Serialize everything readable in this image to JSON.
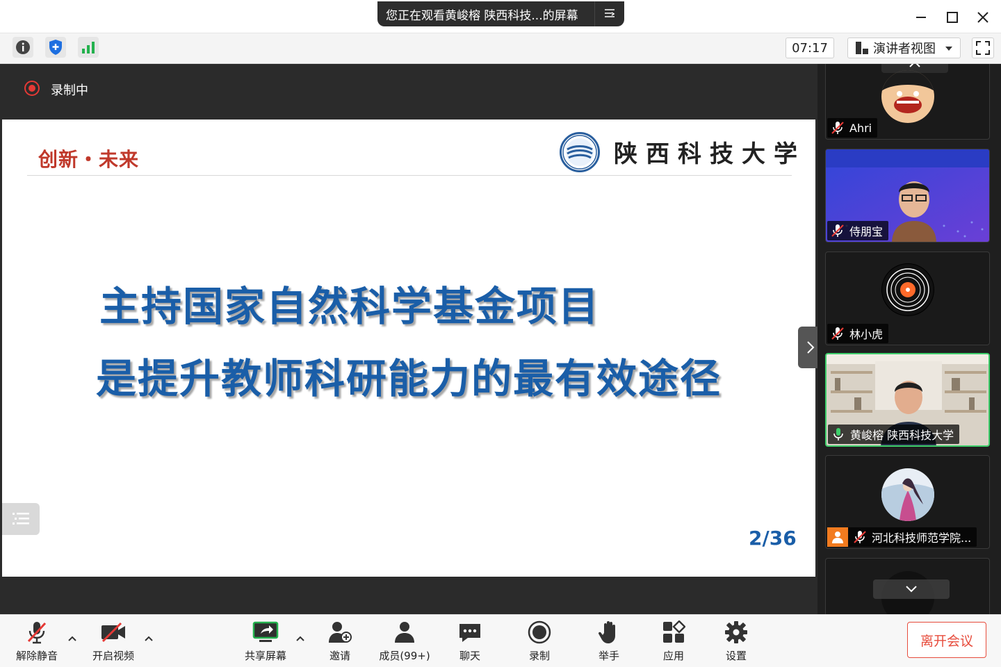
{
  "window": {
    "share_notice": "您正在观看黄峻榕 陕西科技...的屏幕"
  },
  "toolbar": {
    "timer": "07:17",
    "view_label": "演讲者视图"
  },
  "recording": {
    "label": "录制中"
  },
  "slide": {
    "motto": "创新・未来",
    "university": "陕西科技大学",
    "title_line1": "主持国家自然科学基金项目",
    "title_line2": "是提升教师科研能力的最有效途径",
    "page": "2/36"
  },
  "participants": [
    {
      "name": "Ahri",
      "muted": true
    },
    {
      "name": "侍朋宝",
      "muted": true
    },
    {
      "name": "林小虎",
      "muted": true
    },
    {
      "name": "黄峻榕 陕西科技大学",
      "muted": false,
      "speaking": true
    },
    {
      "name": "河北科技师范学院...",
      "muted": true
    }
  ],
  "controls": {
    "unmute": "解除静音",
    "video": "开启视频",
    "share": "共享屏幕",
    "invite": "邀请",
    "members": "成员(99+)",
    "chat": "聊天",
    "record": "录制",
    "raise_hand": "举手",
    "apps": "应用",
    "settings": "设置",
    "leave": "离开会议"
  },
  "colors": {
    "accent_green": "#3ecf6b",
    "record_red": "#e53935",
    "slide_blue": "#1a5ea8",
    "motto_red": "#c0392b",
    "leave_red": "#e74c3c"
  }
}
